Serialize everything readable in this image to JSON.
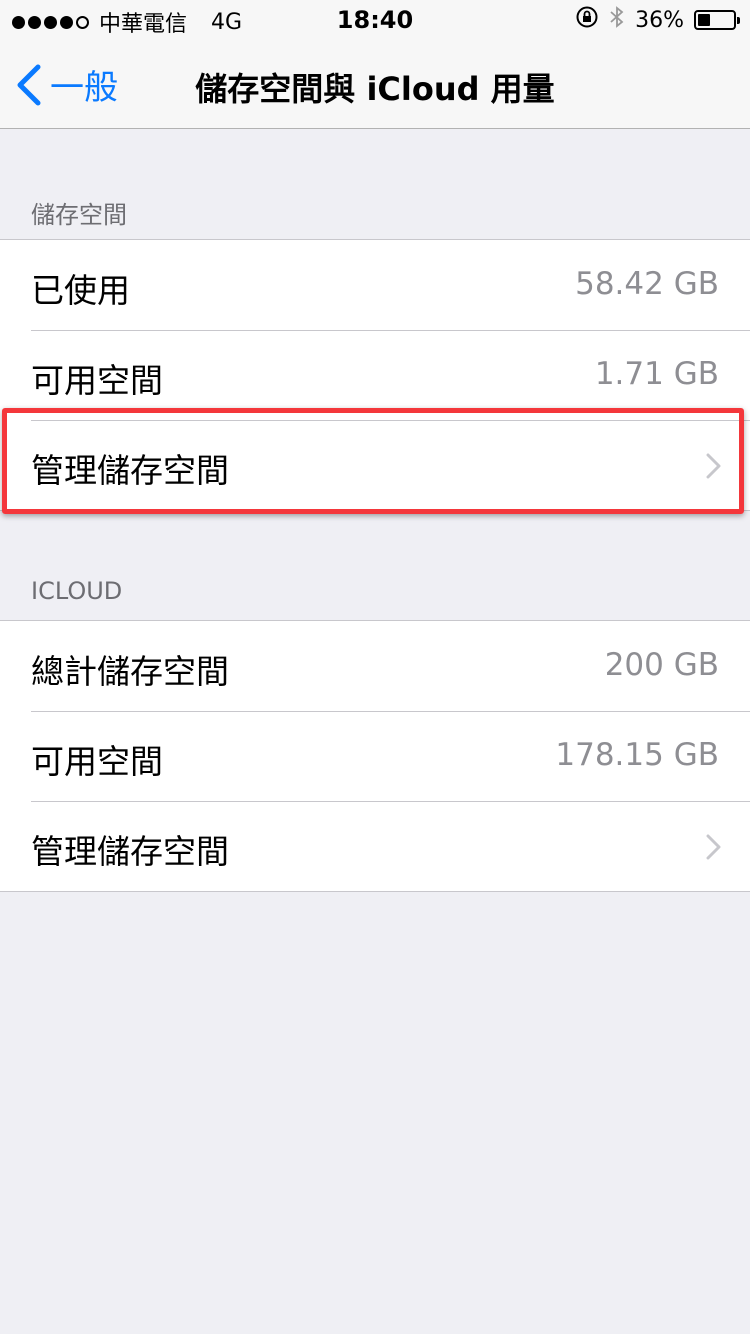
{
  "status_bar": {
    "carrier": "中華電信",
    "network": "4G",
    "time": "18:40",
    "battery_percent_label": "36%",
    "battery_level": 0.36
  },
  "nav": {
    "back_label": "一般",
    "title": "儲存空間與 iCloud 用量"
  },
  "sections": {
    "storage": {
      "header": "儲存空間",
      "used_label": "已使用",
      "used_value": "58.42 GB",
      "available_label": "可用空間",
      "available_value": "1.71 GB",
      "manage_label": "管理儲存空間"
    },
    "icloud": {
      "header": "ICLOUD",
      "total_label": "總計儲存空間",
      "total_value": "200 GB",
      "available_label": "可用空間",
      "available_value": "178.15 GB",
      "manage_label": "管理儲存空間"
    }
  },
  "colors": {
    "accent": "#0a7aff",
    "highlight": "#f4373b",
    "background": "#efeff4",
    "secondary_text": "#8e8e93"
  }
}
